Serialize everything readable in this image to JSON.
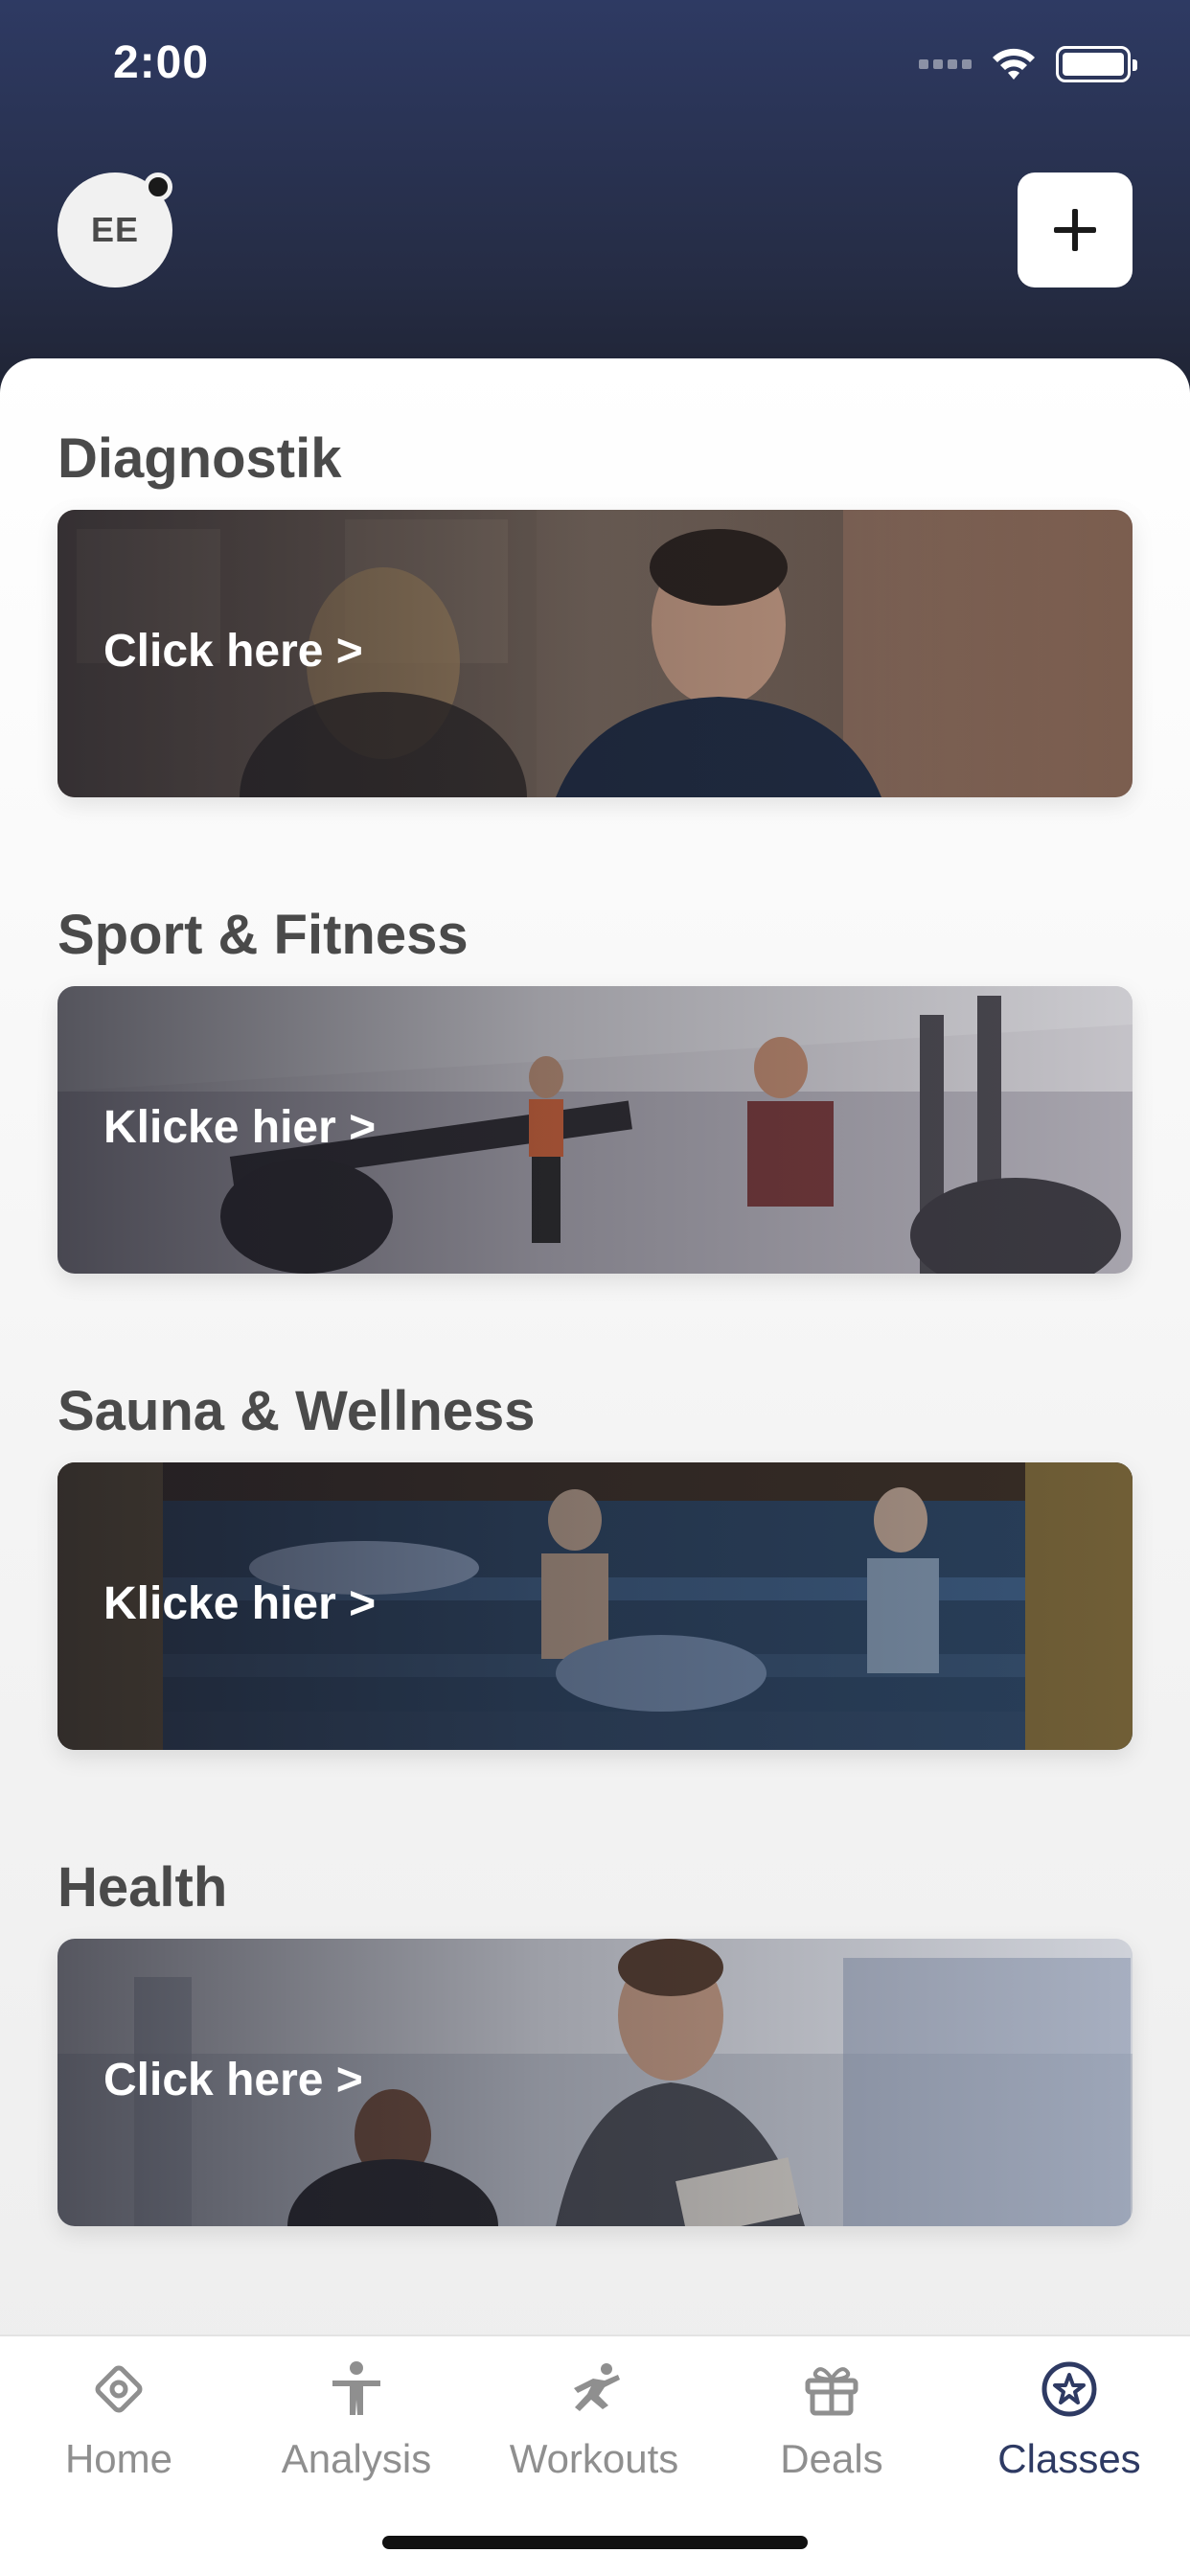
{
  "status_bar": {
    "time": "2:00"
  },
  "header": {
    "avatar_initials": "EE"
  },
  "sections": [
    {
      "title": "Diagnostik",
      "cta": "Click here >"
    },
    {
      "title": "Sport & Fitness",
      "cta": "Klicke hier >"
    },
    {
      "title": "Sauna & Wellness",
      "cta": "Klicke hier >"
    },
    {
      "title": "Health",
      "cta": "Click here >"
    }
  ],
  "tabs": [
    {
      "label": "Home",
      "icon": "home-diamond-icon"
    },
    {
      "label": "Analysis",
      "icon": "person-icon"
    },
    {
      "label": "Workouts",
      "icon": "running-icon"
    },
    {
      "label": "Deals",
      "icon": "gift-icon"
    },
    {
      "label": "Classes",
      "icon": "star-badge-icon",
      "active": true
    }
  ],
  "colors": {
    "header": "#2e3a63",
    "active_tab": "#2e3a63",
    "inactive_tab": "#8f8f8f",
    "section_title": "#4a4a4a"
  }
}
